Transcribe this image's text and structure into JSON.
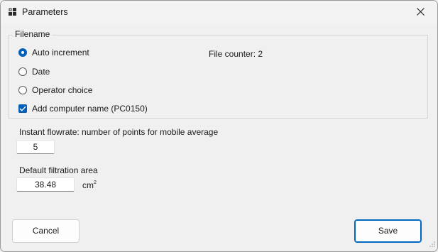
{
  "window": {
    "title": "Parameters",
    "close_icon": "close-icon",
    "app_icon": "app-window-icon"
  },
  "filename_group": {
    "legend": "Filename",
    "options": [
      {
        "label": "Auto increment",
        "selected": true
      },
      {
        "label": "Date",
        "selected": false
      },
      {
        "label": "Operator choice",
        "selected": false
      }
    ],
    "add_computer_name": {
      "label": "Add computer name (PC0150)",
      "checked": true
    },
    "file_counter": "File counter: 2"
  },
  "flowrate": {
    "label": "Instant flowrate: number of points for mobile average",
    "value": "5"
  },
  "filtration": {
    "label": "Default filtration area",
    "value": "38.48",
    "unit": "cm",
    "unit_exp": "2"
  },
  "buttons": {
    "cancel": "Cancel",
    "save": "Save"
  },
  "colors": {
    "accent": "#005fb8",
    "background": "#f0f0f0"
  }
}
